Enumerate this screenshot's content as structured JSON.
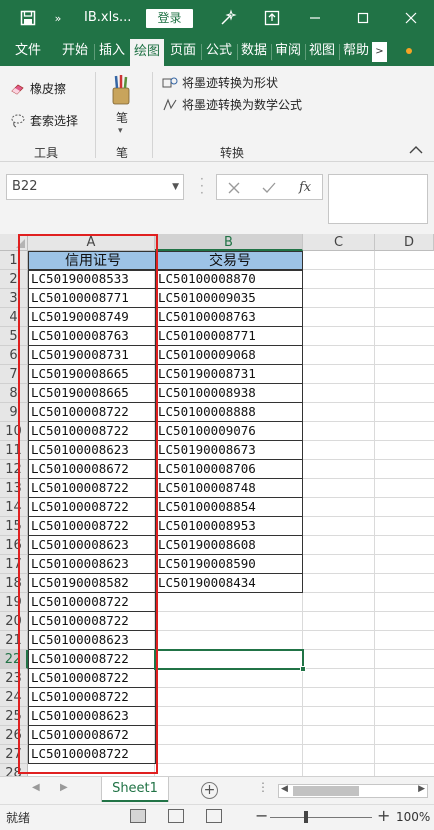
{
  "titlebar": {
    "file_title": "IB.xls...",
    "login_label": "登录",
    "bg_color": "#217346"
  },
  "tabs": [
    {
      "label": "文件",
      "active": false
    },
    {
      "label": "开始",
      "active": false
    },
    {
      "label": "插入",
      "active": false
    },
    {
      "label": "绘图",
      "active": true
    },
    {
      "label": "页面",
      "active": false
    },
    {
      "label": "公式",
      "active": false
    },
    {
      "label": "数据",
      "active": false
    },
    {
      "label": "审阅",
      "active": false
    },
    {
      "label": "视图",
      "active": false
    },
    {
      "label": "帮助",
      "active": false
    }
  ],
  "ribbon": {
    "eraser": "橡皮擦",
    "lasso": "套索选择",
    "tools_group": "工具",
    "pen": "笔",
    "pen_group": "笔",
    "ink_to_shape": "将墨迹转换为形状",
    "ink_to_math": "将墨迹转换为数学公式",
    "convert_group": "转换"
  },
  "formula_bar": {
    "namebox": "B22",
    "fx_label": "fx",
    "formula": ""
  },
  "sheet": {
    "columns": [
      "A",
      "B",
      "C",
      "D"
    ],
    "header_row": {
      "a": "信用证号",
      "b": "交易号"
    },
    "header_fill": "#9dc3e6",
    "rows": [
      {
        "n": "1"
      },
      {
        "n": "2",
        "a": "LC50190008533",
        "b": "LC50100008870"
      },
      {
        "n": "3",
        "a": "LC50100008771",
        "b": "LC50100009035"
      },
      {
        "n": "4",
        "a": "LC50190008749",
        "b": "LC50100008763"
      },
      {
        "n": "5",
        "a": "LC50100008763",
        "b": "LC50100008771"
      },
      {
        "n": "6",
        "a": "LC50190008731",
        "b": "LC50100009068"
      },
      {
        "n": "7",
        "a": "LC50190008665",
        "b": "LC50190008731"
      },
      {
        "n": "8",
        "a": "LC50190008665",
        "b": "LC50100008938"
      },
      {
        "n": "9",
        "a": "LC50100008722",
        "b": "LC50100008888"
      },
      {
        "n": "10",
        "a": "LC50100008722",
        "b": "LC50100009076"
      },
      {
        "n": "11",
        "a": "LC50100008623",
        "b": "LC50190008673"
      },
      {
        "n": "12",
        "a": "LC50100008672",
        "b": "LC50100008706"
      },
      {
        "n": "13",
        "a": "LC50100008722",
        "b": "LC50100008748"
      },
      {
        "n": "14",
        "a": "LC50100008722",
        "b": "LC50100008854"
      },
      {
        "n": "15",
        "a": "LC50100008722",
        "b": "LC50100008953"
      },
      {
        "n": "16",
        "a": "LC50100008623",
        "b": "LC50190008608"
      },
      {
        "n": "17",
        "a": "LC50100008623",
        "b": "LC50190008590"
      },
      {
        "n": "18",
        "a": "LC50190008582",
        "b": "LC50190008434"
      },
      {
        "n": "19",
        "a": "LC50100008722"
      },
      {
        "n": "20",
        "a": "LC50100008722"
      },
      {
        "n": "21",
        "a": "LC50100008623"
      },
      {
        "n": "22",
        "a": "LC50100008722"
      },
      {
        "n": "23",
        "a": "LC50100008722"
      },
      {
        "n": "24",
        "a": "LC50100008722"
      },
      {
        "n": "25",
        "a": "LC50100008623"
      },
      {
        "n": "26",
        "a": "LC50100008672"
      },
      {
        "n": "27",
        "a": "LC50100008722"
      },
      {
        "n": "28"
      }
    ],
    "selected_cell": "B22",
    "highlight_color": "#e02020"
  },
  "sheet_tabs": {
    "active": "Sheet1"
  },
  "statusbar": {
    "status": "就绪",
    "zoom": "100%"
  }
}
